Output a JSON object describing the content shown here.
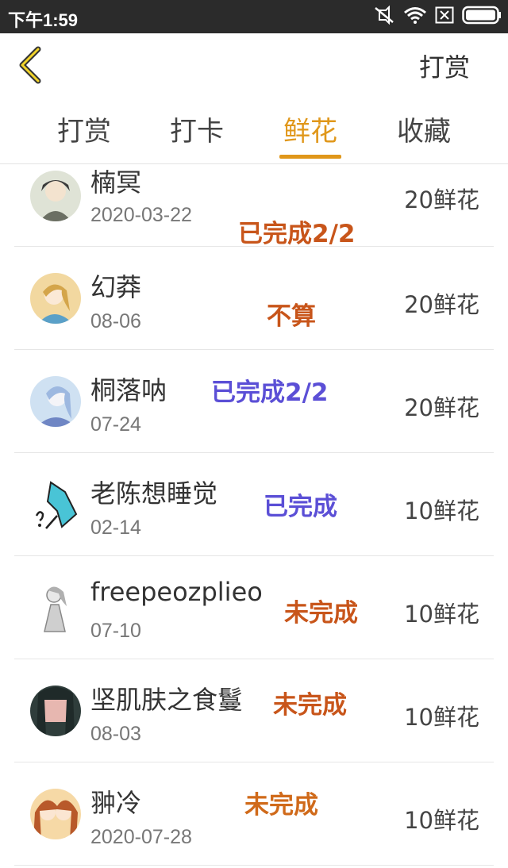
{
  "status_bar": {
    "time": "下午1:59",
    "icons": [
      "mute-icon",
      "wifi-icon",
      "close-box-icon",
      "battery-icon"
    ]
  },
  "header": {
    "back_icon": "chevron-left-icon",
    "action_label": "打赏"
  },
  "tabs": [
    {
      "label": "打赏",
      "active": false
    },
    {
      "label": "打卡",
      "active": false
    },
    {
      "label": "鲜花",
      "active": true
    },
    {
      "label": "收藏",
      "active": false
    }
  ],
  "colors": {
    "accent": "#e0971a",
    "note_orange": "#c8551a",
    "note_blue": "#5b4fd6"
  },
  "rows": [
    {
      "name": "楠冥",
      "date": "2020-03-22",
      "amount": "20鲜花",
      "note": "已完成2/2",
      "note_color": "orange"
    },
    {
      "name": "幻莽",
      "date": "08-06",
      "amount": "20鲜花",
      "note": "不算",
      "note_color": "orange"
    },
    {
      "name": "桐落呐",
      "date": "07-24",
      "amount": "20鲜花",
      "note": "已完成2/2",
      "note_color": "blue"
    },
    {
      "name": "老陈想睡觉",
      "date": "02-14",
      "amount": "10鲜花",
      "note": "已完成",
      "note_color": "blue"
    },
    {
      "name": "freepeozplieo",
      "date": "07-10",
      "amount": "10鲜花",
      "note": "未完成",
      "note_color": "orange"
    },
    {
      "name": "坚肌肤之食鬘",
      "date": "08-03",
      "amount": "10鲜花",
      "note": "未完成",
      "note_color": "orange"
    },
    {
      "name": "翀冷",
      "date": "2020-07-28",
      "amount": "10鲜花",
      "note": "未完成",
      "note_color": "orange"
    }
  ]
}
